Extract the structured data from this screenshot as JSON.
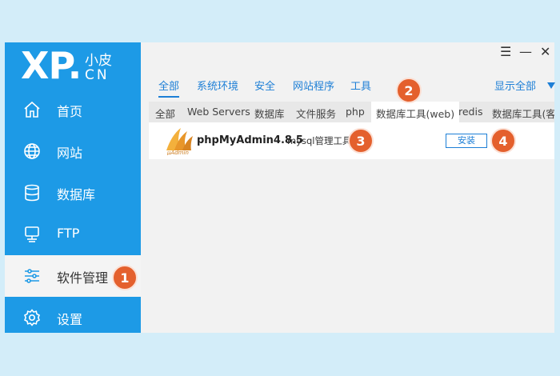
{
  "logo": {
    "xp": "XP",
    "small": "小皮",
    "cn": "CN"
  },
  "sidebar": {
    "items": [
      {
        "label": "首页",
        "icon": "home-icon"
      },
      {
        "label": "网站",
        "icon": "globe-icon"
      },
      {
        "label": "数据库",
        "icon": "database-icon"
      },
      {
        "label": "FTP",
        "icon": "ftp-icon"
      },
      {
        "label": "软件管理",
        "icon": "sliders-icon",
        "active": true
      },
      {
        "label": "设置",
        "icon": "gear-icon"
      }
    ]
  },
  "window_controls": {
    "menu": "☰",
    "minimize": "—",
    "close": "✕"
  },
  "categories": [
    "全部",
    "系统环境",
    "安全",
    "网站程序",
    "工具"
  ],
  "show_all": "显示全部",
  "sub_tabs": [
    "全部",
    "Web Servers",
    "数据库",
    "文件服务",
    "php",
    "数据库工具(web)",
    "redis",
    "数据库工具(客"
  ],
  "software": {
    "name": "phpMyAdmin4.8.5",
    "description": "mysql管理工具",
    "install_label": "安装"
  },
  "badges": [
    "1",
    "2",
    "3",
    "4"
  ],
  "colors": {
    "sidebar": "#1d9ae6",
    "accent": "#1d7fd6",
    "badge": "#e4602d"
  }
}
